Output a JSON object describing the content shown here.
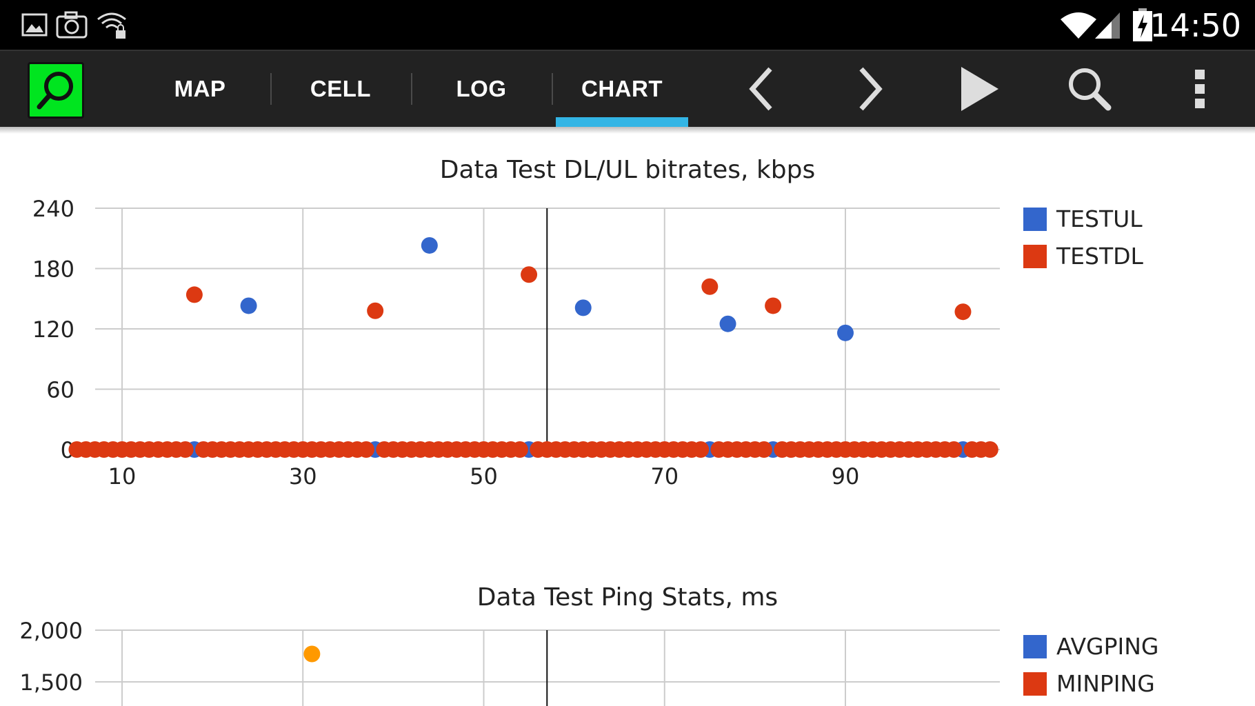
{
  "status_bar": {
    "time": "14:50",
    "left_icons": [
      "image-icon",
      "camera-icon",
      "wifi-lock-icon"
    ],
    "right_icons": [
      "wifi-signal-icon",
      "cell-signal-icon",
      "battery-charging-icon"
    ]
  },
  "action_bar": {
    "logo_icon": "app-search-logo-icon",
    "tabs": [
      {
        "label": "MAP",
        "active": false
      },
      {
        "label": "CELL",
        "active": false
      },
      {
        "label": "LOG",
        "active": false
      },
      {
        "label": "CHART",
        "active": true
      }
    ],
    "buttons": [
      "chevron-left-icon",
      "chevron-right-icon",
      "play-icon",
      "search-icon",
      "overflow-menu-icon"
    ],
    "tab_indicator_color": "#33b5e5"
  },
  "chart_data": [
    {
      "type": "scatter",
      "title": "Data Test DL/UL bitrates, kbps",
      "xlabel": "",
      "ylabel": "",
      "xlim": [
        6,
        106
      ],
      "ylim": [
        0,
        240
      ],
      "x_ticks": [
        "10",
        "30",
        "50",
        "70",
        "90"
      ],
      "x_tick_values": [
        10,
        30,
        50,
        70,
        90
      ],
      "y_ticks": [
        "0",
        "60",
        "120",
        "180",
        "240"
      ],
      "y_tick_values": [
        0,
        60,
        120,
        180,
        240
      ],
      "grid": true,
      "cursor_x": 57,
      "legend_position": "right",
      "series": [
        {
          "name": "TESTUL",
          "color": "#3366cc",
          "points": [
            [
              18,
              0
            ],
            [
              24,
              143
            ],
            [
              38,
              0
            ],
            [
              44,
              203
            ],
            [
              55,
              0
            ],
            [
              61,
              141
            ],
            [
              75,
              0
            ],
            [
              77,
              125
            ],
            [
              82,
              0
            ],
            [
              90,
              116
            ],
            [
              103,
              0
            ]
          ]
        },
        {
          "name": "TESTDL",
          "color": "#dc3912",
          "baseline_zero_x_range": [
            5,
            106
          ],
          "zero_gaps_at_x": [
            18,
            38,
            55,
            75,
            82,
            103
          ],
          "points": [
            [
              18,
              154
            ],
            [
              38,
              138
            ],
            [
              55,
              174
            ],
            [
              75,
              162
            ],
            [
              82,
              143
            ],
            [
              103,
              137
            ]
          ]
        }
      ]
    },
    {
      "type": "scatter",
      "title": "Data Test Ping Stats, ms",
      "xlabel": "",
      "ylabel": "",
      "ylim": [
        1500,
        2000
      ],
      "y_ticks": [
        "1,500",
        "2,000"
      ],
      "y_tick_values": [
        1500,
        2000
      ],
      "grid": true,
      "cursor_x": 57,
      "legend_position": "right",
      "series": [
        {
          "name": "AVGPING",
          "color": "#3366cc",
          "points": []
        },
        {
          "name": "MINPING",
          "color": "#dc3912",
          "points": []
        },
        {
          "name": "",
          "color": "#ff9900",
          "points": [
            [
              31,
              1770
            ]
          ]
        }
      ]
    }
  ]
}
